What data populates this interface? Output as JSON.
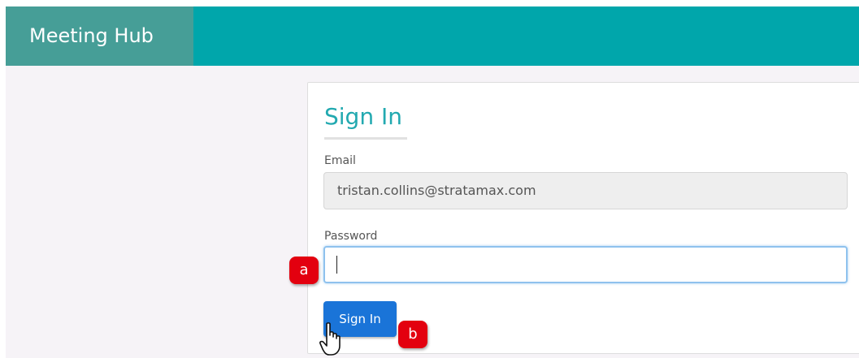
{
  "app": {
    "title": "Meeting Hub"
  },
  "signin": {
    "heading": "Sign In",
    "email_label": "Email",
    "email_value": "tristan.collins@stratamax.com",
    "password_label": "Password",
    "password_value": "",
    "submit_label": "Sign In"
  },
  "annotations": {
    "a": "a",
    "b": "b"
  },
  "icons": {
    "cursor": "hand-pointer-icon"
  },
  "colors": {
    "topbar": "#00a6ab",
    "brand_bg": "#469e97",
    "heading": "#22a9b0",
    "button": "#1a74d8",
    "marker": "#e3000f"
  }
}
